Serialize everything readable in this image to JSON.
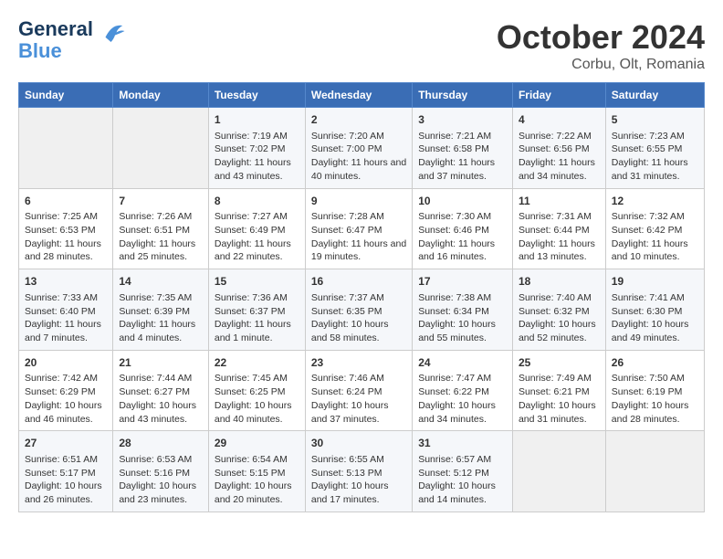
{
  "header": {
    "logo_line1": "General",
    "logo_line2": "Blue",
    "month": "October 2024",
    "location": "Corbu, Olt, Romania"
  },
  "days_of_week": [
    "Sunday",
    "Monday",
    "Tuesday",
    "Wednesday",
    "Thursday",
    "Friday",
    "Saturday"
  ],
  "weeks": [
    [
      {
        "day": "",
        "content": ""
      },
      {
        "day": "",
        "content": ""
      },
      {
        "day": "1",
        "content": "Sunrise: 7:19 AM\nSunset: 7:02 PM\nDaylight: 11 hours and 43 minutes."
      },
      {
        "day": "2",
        "content": "Sunrise: 7:20 AM\nSunset: 7:00 PM\nDaylight: 11 hours and 40 minutes."
      },
      {
        "day": "3",
        "content": "Sunrise: 7:21 AM\nSunset: 6:58 PM\nDaylight: 11 hours and 37 minutes."
      },
      {
        "day": "4",
        "content": "Sunrise: 7:22 AM\nSunset: 6:56 PM\nDaylight: 11 hours and 34 minutes."
      },
      {
        "day": "5",
        "content": "Sunrise: 7:23 AM\nSunset: 6:55 PM\nDaylight: 11 hours and 31 minutes."
      }
    ],
    [
      {
        "day": "6",
        "content": "Sunrise: 7:25 AM\nSunset: 6:53 PM\nDaylight: 11 hours and 28 minutes."
      },
      {
        "day": "7",
        "content": "Sunrise: 7:26 AM\nSunset: 6:51 PM\nDaylight: 11 hours and 25 minutes."
      },
      {
        "day": "8",
        "content": "Sunrise: 7:27 AM\nSunset: 6:49 PM\nDaylight: 11 hours and 22 minutes."
      },
      {
        "day": "9",
        "content": "Sunrise: 7:28 AM\nSunset: 6:47 PM\nDaylight: 11 hours and 19 minutes."
      },
      {
        "day": "10",
        "content": "Sunrise: 7:30 AM\nSunset: 6:46 PM\nDaylight: 11 hours and 16 minutes."
      },
      {
        "day": "11",
        "content": "Sunrise: 7:31 AM\nSunset: 6:44 PM\nDaylight: 11 hours and 13 minutes."
      },
      {
        "day": "12",
        "content": "Sunrise: 7:32 AM\nSunset: 6:42 PM\nDaylight: 11 hours and 10 minutes."
      }
    ],
    [
      {
        "day": "13",
        "content": "Sunrise: 7:33 AM\nSunset: 6:40 PM\nDaylight: 11 hours and 7 minutes."
      },
      {
        "day": "14",
        "content": "Sunrise: 7:35 AM\nSunset: 6:39 PM\nDaylight: 11 hours and 4 minutes."
      },
      {
        "day": "15",
        "content": "Sunrise: 7:36 AM\nSunset: 6:37 PM\nDaylight: 11 hours and 1 minute."
      },
      {
        "day": "16",
        "content": "Sunrise: 7:37 AM\nSunset: 6:35 PM\nDaylight: 10 hours and 58 minutes."
      },
      {
        "day": "17",
        "content": "Sunrise: 7:38 AM\nSunset: 6:34 PM\nDaylight: 10 hours and 55 minutes."
      },
      {
        "day": "18",
        "content": "Sunrise: 7:40 AM\nSunset: 6:32 PM\nDaylight: 10 hours and 52 minutes."
      },
      {
        "day": "19",
        "content": "Sunrise: 7:41 AM\nSunset: 6:30 PM\nDaylight: 10 hours and 49 minutes."
      }
    ],
    [
      {
        "day": "20",
        "content": "Sunrise: 7:42 AM\nSunset: 6:29 PM\nDaylight: 10 hours and 46 minutes."
      },
      {
        "day": "21",
        "content": "Sunrise: 7:44 AM\nSunset: 6:27 PM\nDaylight: 10 hours and 43 minutes."
      },
      {
        "day": "22",
        "content": "Sunrise: 7:45 AM\nSunset: 6:25 PM\nDaylight: 10 hours and 40 minutes."
      },
      {
        "day": "23",
        "content": "Sunrise: 7:46 AM\nSunset: 6:24 PM\nDaylight: 10 hours and 37 minutes."
      },
      {
        "day": "24",
        "content": "Sunrise: 7:47 AM\nSunset: 6:22 PM\nDaylight: 10 hours and 34 minutes."
      },
      {
        "day": "25",
        "content": "Sunrise: 7:49 AM\nSunset: 6:21 PM\nDaylight: 10 hours and 31 minutes."
      },
      {
        "day": "26",
        "content": "Sunrise: 7:50 AM\nSunset: 6:19 PM\nDaylight: 10 hours and 28 minutes."
      }
    ],
    [
      {
        "day": "27",
        "content": "Sunrise: 6:51 AM\nSunset: 5:17 PM\nDaylight: 10 hours and 26 minutes."
      },
      {
        "day": "28",
        "content": "Sunrise: 6:53 AM\nSunset: 5:16 PM\nDaylight: 10 hours and 23 minutes."
      },
      {
        "day": "29",
        "content": "Sunrise: 6:54 AM\nSunset: 5:15 PM\nDaylight: 10 hours and 20 minutes."
      },
      {
        "day": "30",
        "content": "Sunrise: 6:55 AM\nSunset: 5:13 PM\nDaylight: 10 hours and 17 minutes."
      },
      {
        "day": "31",
        "content": "Sunrise: 6:57 AM\nSunset: 5:12 PM\nDaylight: 10 hours and 14 minutes."
      },
      {
        "day": "",
        "content": ""
      },
      {
        "day": "",
        "content": ""
      }
    ]
  ]
}
